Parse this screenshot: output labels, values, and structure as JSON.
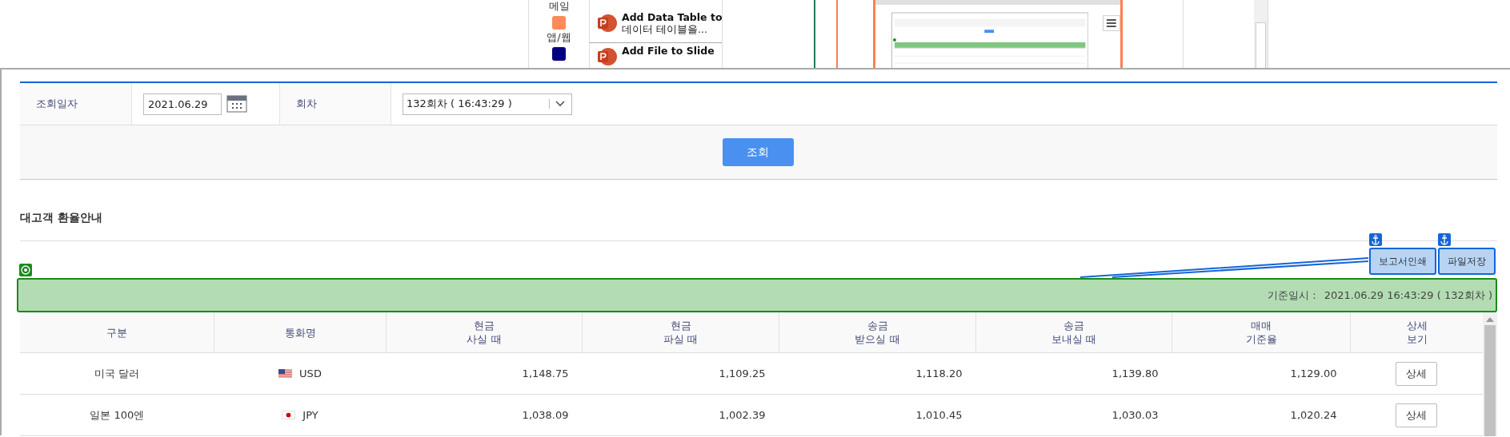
{
  "popup": {
    "categories": [
      {
        "label": "메일"
      },
      {
        "label": "앱/웹",
        "color": "#ff8a5b"
      },
      {
        "color": "#000080"
      }
    ],
    "actions": [
      {
        "title": "Add Data Table to",
        "description": "데이터 테이블을..."
      },
      {
        "title": "Add File to Slide"
      }
    ]
  },
  "form": {
    "date_label": "조회일자",
    "date_value": "2021.06.29",
    "round_label": "회차",
    "round_value": "132회차 ( 16:43:29 )",
    "search_button": "조회"
  },
  "section_title": "대고객 환율안내",
  "toolbar_buttons": [
    {
      "label": "보고서인쇄",
      "anchored": true
    },
    {
      "label": "파일저장",
      "anchored": true
    }
  ],
  "base_time": {
    "label": "기준일시 :",
    "value": "2021.06.29 16:43:29 ( 132회차 )"
  },
  "table": {
    "columns": [
      [
        "구분"
      ],
      [
        "통화명"
      ],
      [
        "현금",
        "사실 때"
      ],
      [
        "현금",
        "파실 때"
      ],
      [
        "송금",
        "받으실 때"
      ],
      [
        "송금",
        "보내실 때"
      ],
      [
        "매매",
        "기준율"
      ],
      [
        "상세",
        "보기"
      ]
    ],
    "rows": [
      {
        "name": "미국 달러",
        "kind": "us",
        "code": "USD",
        "cash_buy": "1,148.75",
        "cash_sell": "1,109.25",
        "send_receive": "1,118.20",
        "send_send": "1,139.80",
        "base_rate": "1,129.00",
        "detail": "상세"
      },
      {
        "name": "일본 100엔",
        "kind": "jp",
        "code": "JPY",
        "cash_buy": "1,038.09",
        "cash_sell": "1,002.39",
        "send_receive": "1,010.45",
        "send_send": "1,030.03",
        "base_rate": "1,020.24",
        "detail": "상세"
      }
    ]
  }
}
